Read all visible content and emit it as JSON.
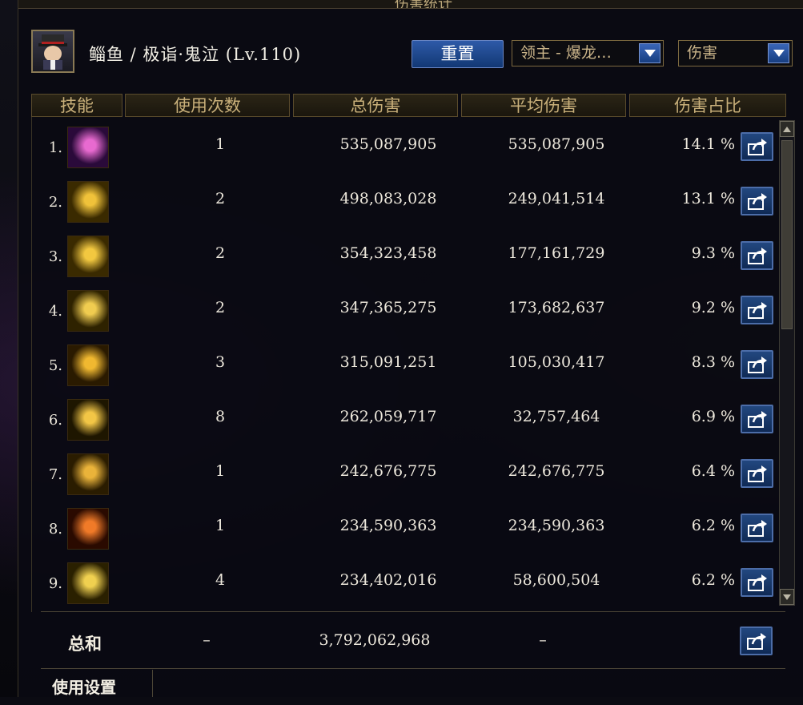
{
  "window": {
    "title": "伤害统计"
  },
  "character": {
    "name": "鲻鱼 / 极诣·鬼泣 (Lv.110)"
  },
  "toolbar": {
    "reset_label": "重置",
    "target_select": "领主 - 爆龙…",
    "type_select": "伤害"
  },
  "columns": [
    "技能",
    "使用次数",
    "总伤害",
    "平均伤害",
    "伤害占比"
  ],
  "rows": [
    {
      "rank": "1.",
      "uses": "1",
      "total": "535,087,905",
      "avg": "535,087,905",
      "pct": "14.1 %",
      "icon_colors": [
        "#2a0a3a",
        "#e86ad0"
      ]
    },
    {
      "rank": "2.",
      "uses": "2",
      "total": "498,083,028",
      "avg": "249,041,514",
      "pct": "13.1 %",
      "icon_colors": [
        "#3a2a00",
        "#f0c23a"
      ]
    },
    {
      "rank": "3.",
      "uses": "2",
      "total": "354,323,458",
      "avg": "177,161,729",
      "pct": "9.3 %",
      "icon_colors": [
        "#3a2a00",
        "#f2c840"
      ]
    },
    {
      "rank": "4.",
      "uses": "2",
      "total": "347,365,275",
      "avg": "173,682,637",
      "pct": "9.2 %",
      "icon_colors": [
        "#2e2200",
        "#f0cc50"
      ]
    },
    {
      "rank": "5.",
      "uses": "3",
      "total": "315,091,251",
      "avg": "105,030,417",
      "pct": "8.3 %",
      "icon_colors": [
        "#2a1a00",
        "#f0b830"
      ]
    },
    {
      "rank": "6.",
      "uses": "8",
      "total": "262,059,717",
      "avg": "32,757,464",
      "pct": "6.9 %",
      "icon_colors": [
        "#1e1600",
        "#f2c646"
      ]
    },
    {
      "rank": "7.",
      "uses": "1",
      "total": "242,676,775",
      "avg": "242,676,775",
      "pct": "6.4 %",
      "icon_colors": [
        "#2a1c00",
        "#eab33a"
      ]
    },
    {
      "rank": "8.",
      "uses": "1",
      "total": "234,590,363",
      "avg": "234,590,363",
      "pct": "6.2 %",
      "icon_colors": [
        "#2a0a00",
        "#f07a28"
      ]
    },
    {
      "rank": "9.",
      "uses": "4",
      "total": "234,402,016",
      "avg": "58,600,504",
      "pct": "6.2 %",
      "icon_colors": [
        "#2a2000",
        "#f0d050"
      ]
    }
  ],
  "total": {
    "label": "总和",
    "uses": "–",
    "total": "3,792,062,968",
    "avg": "–"
  },
  "settings": {
    "label": "使用设置"
  }
}
